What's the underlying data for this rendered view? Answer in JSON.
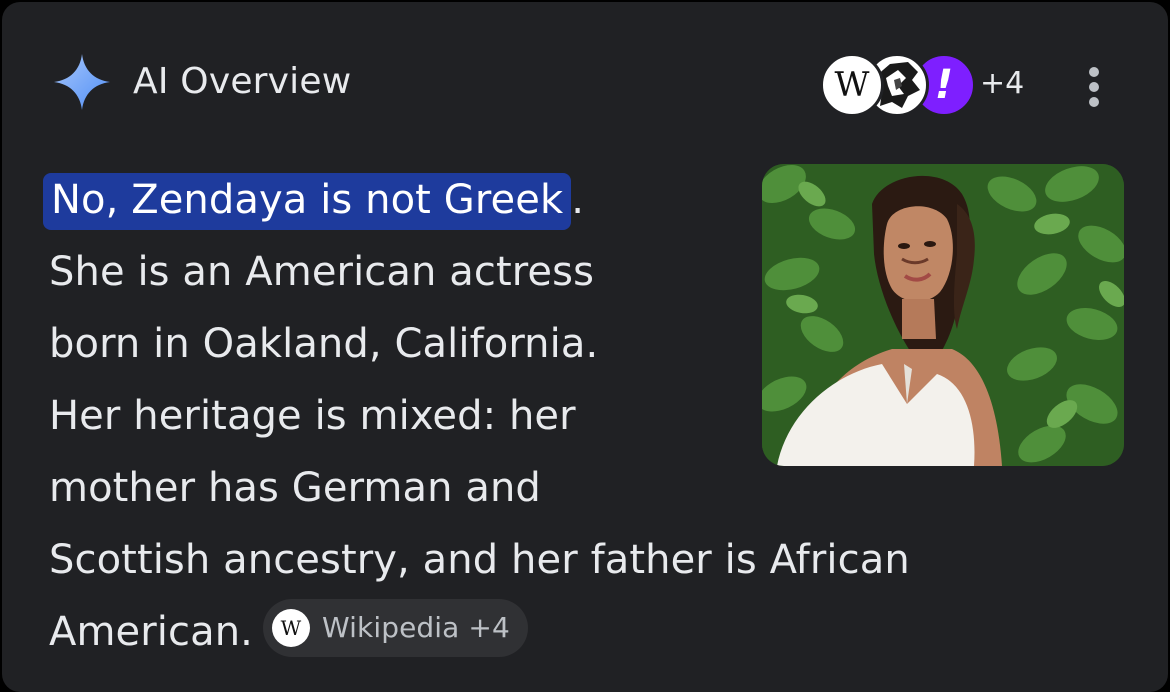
{
  "header": {
    "title": "AI Overview",
    "source_icons": [
      "wikipedia-icon",
      "news-source-icon",
      "yahoo-icon"
    ],
    "wiki_letter": "W",
    "yahoo_glyph": "!",
    "source_count": "+4",
    "menu_icon": "more-vert-icon"
  },
  "answer": {
    "highlight": "No, Zendaya is not Greek",
    "highlight_tail": ".",
    "lines": [
      "She is an American actress",
      "born in Oakland, California.",
      "Her heritage is mixed: her",
      "mother has German and",
      "Scottish ancestry, and her father is African"
    ],
    "last_line": "American.",
    "citation": {
      "icon_letter": "W",
      "label": "Wikipedia +4"
    }
  },
  "colors": {
    "background": "#202124",
    "text": "#e8eaed",
    "highlight": "#1e3b9d",
    "chip": "#303134",
    "sparkle": "#8ab4f8",
    "yahoo": "#7e1fff"
  }
}
